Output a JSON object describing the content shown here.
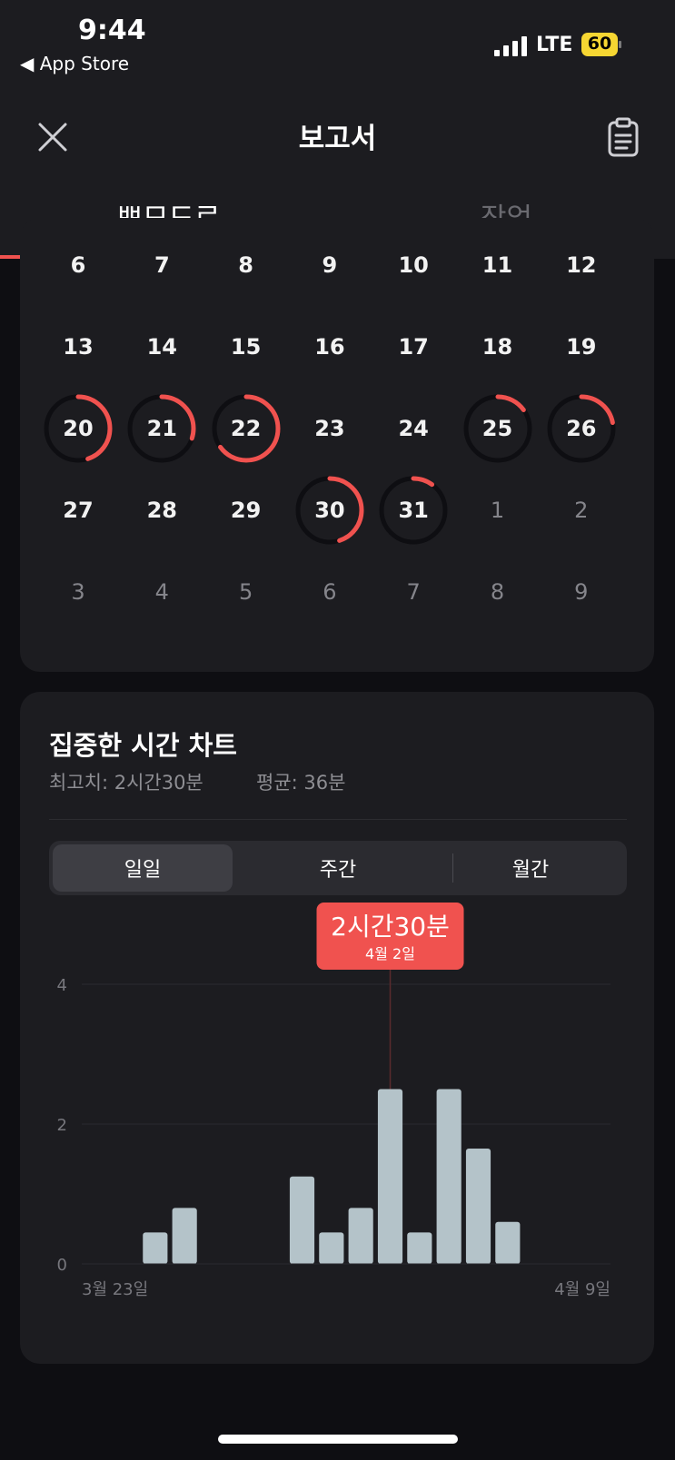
{
  "status_bar": {
    "time": "9:44",
    "back_label": "◀ App Store",
    "network": "LTE",
    "battery": "60"
  },
  "header": {
    "title": "보고서",
    "tabs": [
      {
        "label": "뽀모도로",
        "active": true
      },
      {
        "label": "작업",
        "active": false
      }
    ]
  },
  "calendar": {
    "rows": [
      [
        {
          "d": "6"
        },
        {
          "d": "7"
        },
        {
          "d": "8"
        },
        {
          "d": "9"
        },
        {
          "d": "10"
        },
        {
          "d": "11"
        },
        {
          "d": "12"
        }
      ],
      [
        {
          "d": "13"
        },
        {
          "d": "14"
        },
        {
          "d": "15"
        },
        {
          "d": "16"
        },
        {
          "d": "17"
        },
        {
          "d": "18"
        },
        {
          "d": "19"
        }
      ],
      [
        {
          "d": "20",
          "p": 0.45
        },
        {
          "d": "21",
          "p": 0.3
        },
        {
          "d": "22",
          "p": 0.65
        },
        {
          "d": "23"
        },
        {
          "d": "24"
        },
        {
          "d": "25",
          "p": 0.15
        },
        {
          "d": "26",
          "p": 0.22
        }
      ],
      [
        {
          "d": "27"
        },
        {
          "d": "28"
        },
        {
          "d": "29"
        },
        {
          "d": "30",
          "p": 0.45
        },
        {
          "d": "31",
          "p": 0.1
        },
        {
          "d": "1",
          "dim": true
        },
        {
          "d": "2",
          "dim": true
        }
      ],
      [
        {
          "d": "3",
          "dim": true
        },
        {
          "d": "4",
          "dim": true
        },
        {
          "d": "5",
          "dim": true
        },
        {
          "d": "6",
          "dim": true
        },
        {
          "d": "7",
          "dim": true
        },
        {
          "d": "8",
          "dim": true
        },
        {
          "d": "9",
          "dim": true
        }
      ]
    ],
    "ring_color": "#f0524f"
  },
  "focus_chart": {
    "title": "집중한 시간 차트",
    "max_label": "최고치: 2시간30분",
    "avg_label": "평균: 36분",
    "segments": [
      "일일",
      "주간",
      "월간"
    ],
    "selected_segment": "일일",
    "tooltip": {
      "value": "2시간30분",
      "date": "4월 2일"
    }
  },
  "chart_data": {
    "type": "bar",
    "x_start_label": "3월 23일",
    "x_end_label": "4월 9일",
    "categories": [
      "3/23",
      "3/24",
      "3/25",
      "3/26",
      "3/27",
      "3/28",
      "3/29",
      "3/30",
      "3/31",
      "4/1",
      "4/2",
      "4/3",
      "4/4",
      "4/5",
      "4/6",
      "4/7",
      "4/8",
      "4/9"
    ],
    "values": [
      0,
      0,
      0.45,
      0.8,
      0,
      0,
      0,
      1.25,
      0.45,
      0.8,
      2.5,
      0.45,
      2.5,
      1.65,
      0.6,
      0,
      0,
      0
    ],
    "yticks": [
      0,
      2,
      4
    ],
    "ylim": [
      0,
      4
    ],
    "highlight_index": 10,
    "bar_color": "#b4c3c9",
    "grid": true
  }
}
